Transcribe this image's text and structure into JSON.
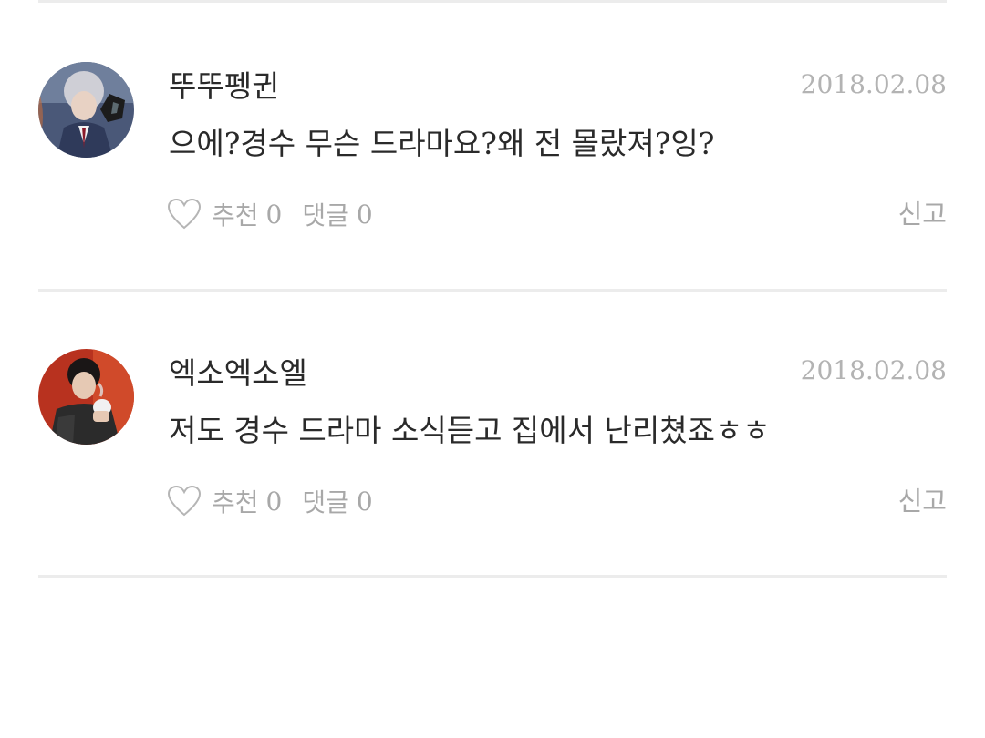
{
  "comments": [
    {
      "author": "뚜뚜펭귄",
      "date": "2018.02.08",
      "text": "으에?경수 무슨 드라마요?왜 전 몰랐져?잉?",
      "like_label": "추천",
      "like_count": "0",
      "reply_label": "댓글",
      "reply_count": "0",
      "report_label": "신고",
      "like_icon": "heart-outline-icon"
    },
    {
      "author": "엑소엑소엘",
      "date": "2018.02.08",
      "text": "저도 경수 드라마 소식듣고 집에서 난리쳤죠ㅎㅎ",
      "like_label": "추천",
      "like_count": "0",
      "reply_label": "댓글",
      "reply_count": "0",
      "report_label": "신고",
      "like_icon": "heart-outline-icon"
    }
  ],
  "colors": {
    "text": "#2a2a2a",
    "muted": "#a8a8a8",
    "date": "#b3b3b3",
    "divider": "#ececec"
  }
}
